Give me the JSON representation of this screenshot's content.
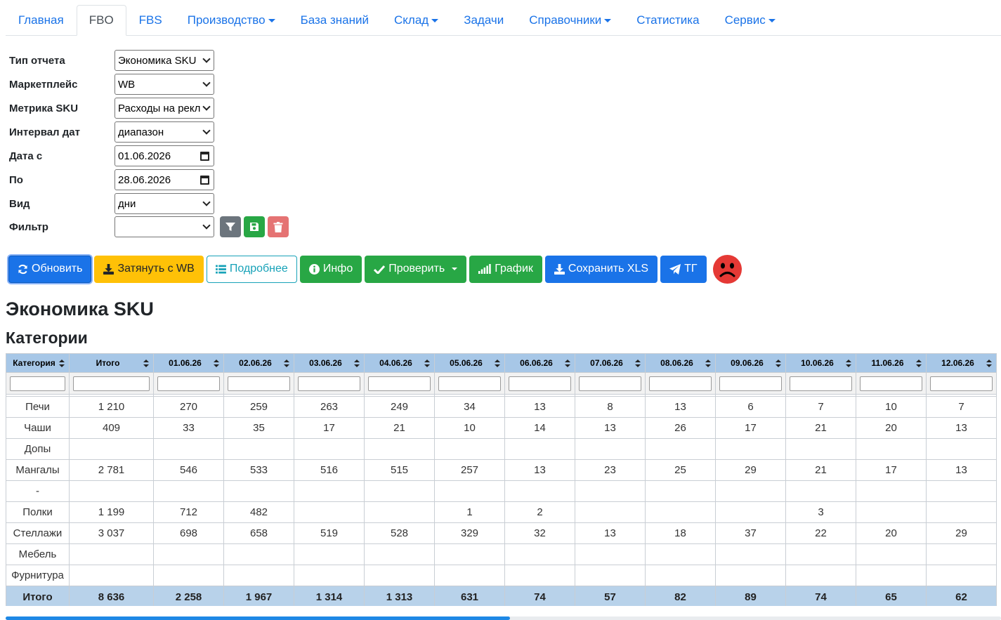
{
  "nav": {
    "tabs": [
      {
        "label": "Главная",
        "dropdown": false,
        "active": false
      },
      {
        "label": "FBO",
        "dropdown": false,
        "active": true
      },
      {
        "label": "FBS",
        "dropdown": false,
        "active": false
      },
      {
        "label": "Производство",
        "dropdown": true,
        "active": false
      },
      {
        "label": "База знаний",
        "dropdown": false,
        "active": false
      },
      {
        "label": "Склад",
        "dropdown": true,
        "active": false
      },
      {
        "label": "Задачи",
        "dropdown": false,
        "active": false
      },
      {
        "label": "Справочники",
        "dropdown": true,
        "active": false
      },
      {
        "label": "Статистика",
        "dropdown": false,
        "active": false
      },
      {
        "label": "Сервис",
        "dropdown": true,
        "active": false
      }
    ]
  },
  "form": {
    "report_type": {
      "label": "Тип отчета",
      "value": "Экономика SKU"
    },
    "marketplace": {
      "label": "Маркетплейс",
      "value": "WB"
    },
    "metric": {
      "label": "Метрика SKU",
      "value": "Расходы на рекл"
    },
    "interval": {
      "label": "Интервал дат",
      "value": "диапазон"
    },
    "date_from": {
      "label": "Дата с",
      "value": "01.06.2026"
    },
    "date_to": {
      "label": "По",
      "value": "28.06.2026"
    },
    "view": {
      "label": "Вид",
      "value": "дни"
    },
    "filter": {
      "label": "Фильтр",
      "value": ""
    }
  },
  "toolbar": {
    "refresh": "Обновить",
    "pull": "Затянуть с WB",
    "details": "Подробнее",
    "info": "Инфо",
    "check": "Проверить",
    "chart": "График",
    "save_xls": "Сохранить XLS",
    "tg": "ТГ"
  },
  "colors": {
    "primary": "#1a73e8",
    "warning": "#ffc107",
    "info_outline": "#17a2b8",
    "success": "#28a745",
    "danger_light": "#e57373",
    "header_bg": "#a7c7e7",
    "footer_bg": "#b8d2ea",
    "sad": "#e53935"
  },
  "titles": {
    "main": "Экономика SKU",
    "section": "Категории"
  },
  "table": {
    "headers": [
      "Категория",
      "Итого",
      "01.06.26",
      "02.06.26",
      "03.06.26",
      "04.06.26",
      "05.06.26",
      "06.06.26",
      "07.06.26",
      "08.06.26",
      "09.06.26",
      "10.06.26",
      "11.06.26",
      "12.06.26"
    ],
    "rows": [
      [
        "Печи",
        "1 210",
        "270",
        "259",
        "263",
        "249",
        "34",
        "13",
        "8",
        "13",
        "6",
        "7",
        "10",
        "7"
      ],
      [
        "Чаши",
        "409",
        "33",
        "35",
        "17",
        "21",
        "10",
        "14",
        "13",
        "26",
        "17",
        "21",
        "20",
        "13"
      ],
      [
        "Допы",
        "",
        "",
        "",
        "",
        "",
        "",
        "",
        "",
        "",
        "",
        "",
        "",
        ""
      ],
      [
        "Мангалы",
        "2 781",
        "546",
        "533",
        "516",
        "515",
        "257",
        "13",
        "23",
        "25",
        "29",
        "21",
        "17",
        "13"
      ],
      [
        "-",
        "",
        "",
        "",
        "",
        "",
        "",
        "",
        "",
        "",
        "",
        "",
        "",
        ""
      ],
      [
        "Полки",
        "1 199",
        "712",
        "482",
        "",
        "",
        "1",
        "2",
        "",
        "",
        "",
        "3",
        "",
        ""
      ],
      [
        "Стеллажи",
        "3 037",
        "698",
        "658",
        "519",
        "528",
        "329",
        "32",
        "13",
        "18",
        "37",
        "22",
        "20",
        "29"
      ],
      [
        "Мебель",
        "",
        "",
        "",
        "",
        "",
        "",
        "",
        "",
        "",
        "",
        "",
        "",
        ""
      ],
      [
        "Фурнитура",
        "",
        "",
        "",
        "",
        "",
        "",
        "",
        "",
        "",
        "",
        "",
        "",
        ""
      ]
    ],
    "footer": [
      "Итого",
      "8 636",
      "2 258",
      "1 967",
      "1 314",
      "1 313",
      "631",
      "74",
      "57",
      "82",
      "89",
      "74",
      "65",
      "62"
    ]
  },
  "scroll": {
    "thumb_fraction": 0.507
  }
}
